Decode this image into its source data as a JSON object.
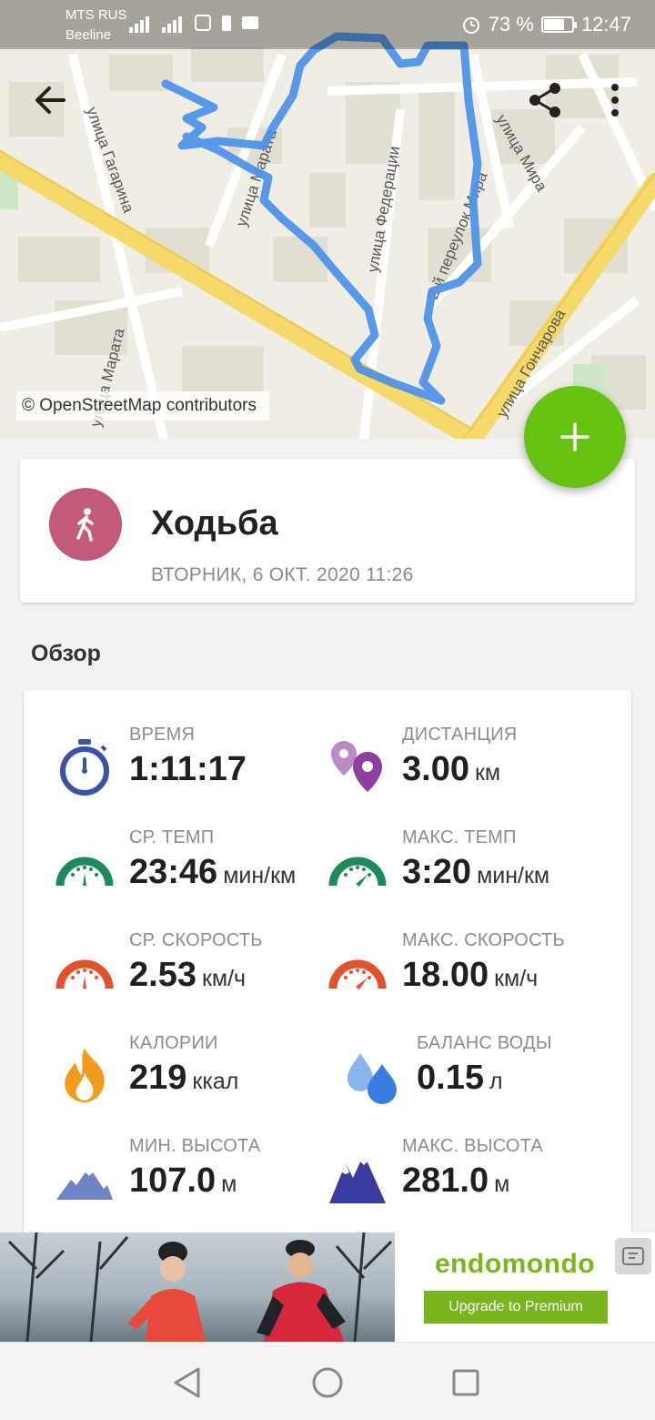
{
  "status_bar": {
    "carrier_primary": "MTS RUS",
    "carrier_secondary": "Beeline",
    "battery_percent": "73 %",
    "battery_level": 0.73,
    "time": "12:47"
  },
  "map": {
    "attribution": "© OpenStreetMap contributors",
    "streets": [
      "Мира",
      "Федерации",
      "улица Мира",
      "2-й переулок Мира",
      "улица Гончарова",
      "улица Гагарина",
      "улица Марата"
    ]
  },
  "activity": {
    "name": "Ходьба",
    "datetime": "ВТОРНИК, 6 ОКТ. 2020 11:26",
    "avatar_color": "#c25a78"
  },
  "overview": {
    "title": "Обзор",
    "stats": [
      {
        "label": "ВРЕМЯ",
        "value": "1:11:17",
        "unit": "",
        "icon": "stopwatch-icon"
      },
      {
        "label": "ДИСТАНЦИЯ",
        "value": "3.00",
        "unit": "км",
        "icon": "distance-pin-icon"
      },
      {
        "label": "СР. ТЕМП",
        "value": "23:46",
        "unit": "мин/км",
        "icon": "avg-pace-gauge-icon"
      },
      {
        "label": "МАКС. ТЕМП",
        "value": "3:20",
        "unit": "мин/км",
        "icon": "max-pace-gauge-icon"
      },
      {
        "label": "СР. СКОРОСТЬ",
        "value": "2.53",
        "unit": "км/ч",
        "icon": "avg-speed-gauge-icon"
      },
      {
        "label": "МАКС. СКОРОСТЬ",
        "value": "18.00",
        "unit": "км/ч",
        "icon": "max-speed-gauge-icon"
      },
      {
        "label": "КАЛОРИИ",
        "value": "219",
        "unit": "ккал",
        "icon": "flame-icon"
      },
      {
        "label": "БАЛАНС ВОДЫ",
        "value": "0.15",
        "unit": "л",
        "icon": "water-drops-icon"
      },
      {
        "label": "МИН. ВЫСОТА",
        "value": "107.0",
        "unit": "м",
        "icon": "min-altitude-mountain-icon"
      },
      {
        "label": "МАКС. ВЫСОТА",
        "value": "281.0",
        "unit": "м",
        "icon": "max-altitude-mountain-icon"
      }
    ]
  },
  "ad": {
    "brand": "endomondo",
    "cta": "Upgrade to Premium"
  },
  "colors": {
    "fab": "#66c312",
    "route": "#4a90e8",
    "ad_green": "#7ab51d"
  }
}
